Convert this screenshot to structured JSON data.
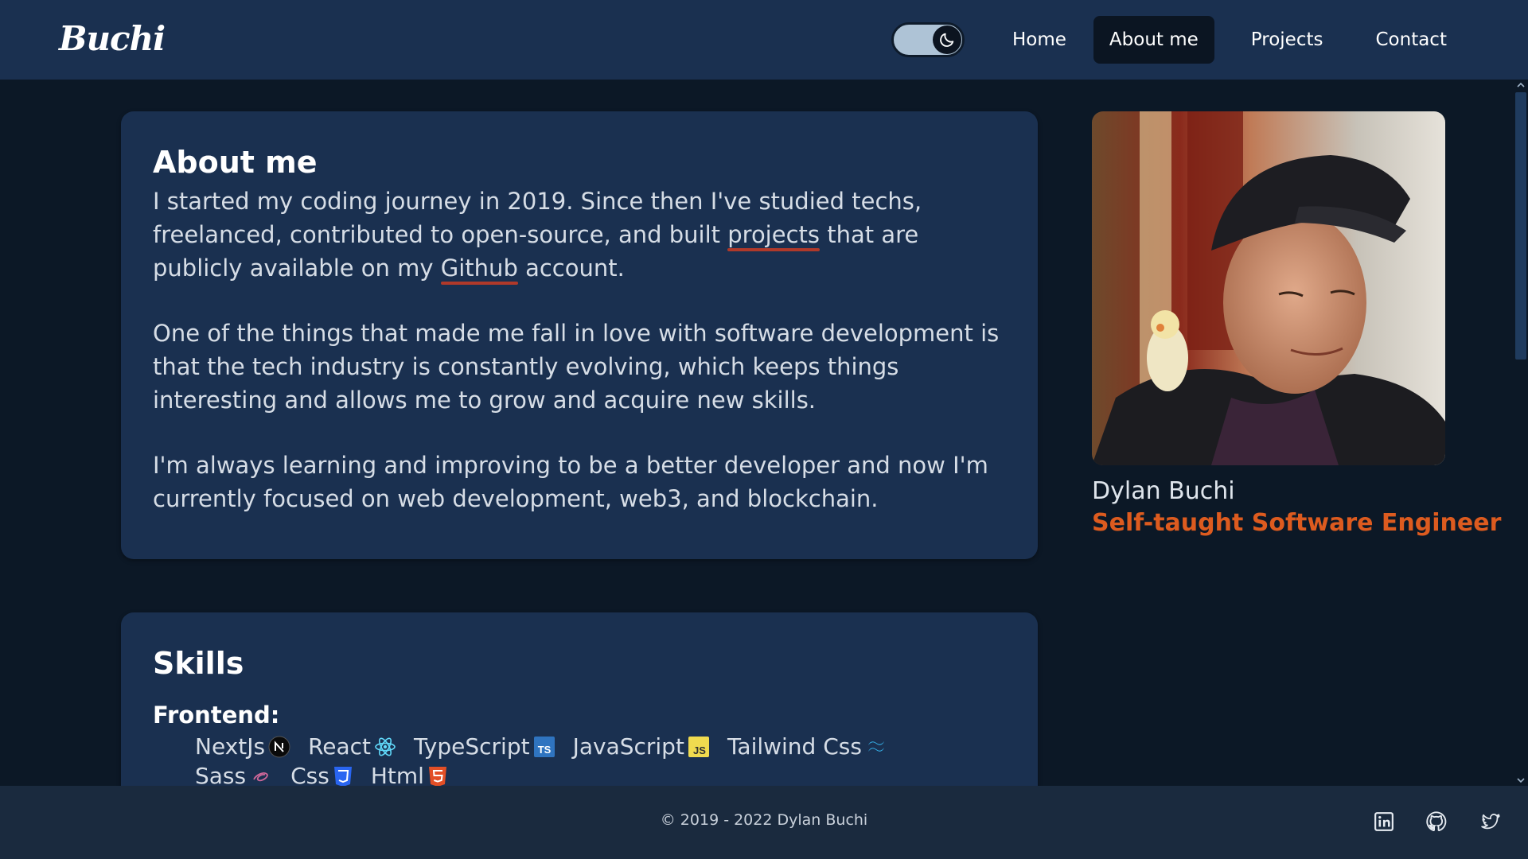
{
  "brand": {
    "logo_text": "Buchi"
  },
  "theme_toggle": {
    "mode": "dark",
    "icon": "moon-icon"
  },
  "nav": {
    "items": [
      {
        "label": "Home",
        "active": false
      },
      {
        "label": "About me",
        "active": true
      },
      {
        "label": "Projects",
        "active": false
      },
      {
        "label": "Contact",
        "active": false
      }
    ]
  },
  "about": {
    "title": "About me",
    "p1_before_projects": "I started my coding journey in 2019. Since then I've studied techs, freelanced, contributed to open-source, and built ",
    "link_projects": "projects",
    "p1_between": " that are publicly available on my ",
    "link_github": "Github",
    "p1_after": " account.",
    "p2": "One of the things that made me fall in love with software development is that the tech industry is constantly evolving, which keeps things interesting and allows me to grow and acquire new skills.",
    "p3": "I'm always learning and improving to be a better developer and now I'm currently focused on web development, web3, and blockchain."
  },
  "skills": {
    "title": "Skills",
    "frontend_label": "Frontend:",
    "frontend": [
      {
        "name": "NextJs",
        "icon": "nextjs-icon"
      },
      {
        "name": "React",
        "icon": "react-icon"
      },
      {
        "name": "TypeScript",
        "icon": "typescript-icon"
      },
      {
        "name": "JavaScript",
        "icon": "javascript-icon"
      },
      {
        "name": "Tailwind Css",
        "icon": "tailwind-icon"
      },
      {
        "name": "Sass",
        "icon": "sass-icon"
      },
      {
        "name": "Css",
        "icon": "css3-icon"
      },
      {
        "name": "Html",
        "icon": "html5-icon"
      }
    ]
  },
  "profile": {
    "name": "Dylan Buchi",
    "role": "Self-taught Software Engineer",
    "photo_icon": "profile-photo"
  },
  "footer": {
    "copyright": "© 2019 - 2022  Dylan Buchi",
    "social": [
      "linkedin-icon",
      "github-icon",
      "twitter-icon"
    ]
  },
  "colors": {
    "header_bg": "#1a3050",
    "page_bg": "#0c1826",
    "card_bg": "#1a3050",
    "accent": "#dd5b1f",
    "link_underline": "#b0392a",
    "footer_bg": "#1a2a3e"
  }
}
